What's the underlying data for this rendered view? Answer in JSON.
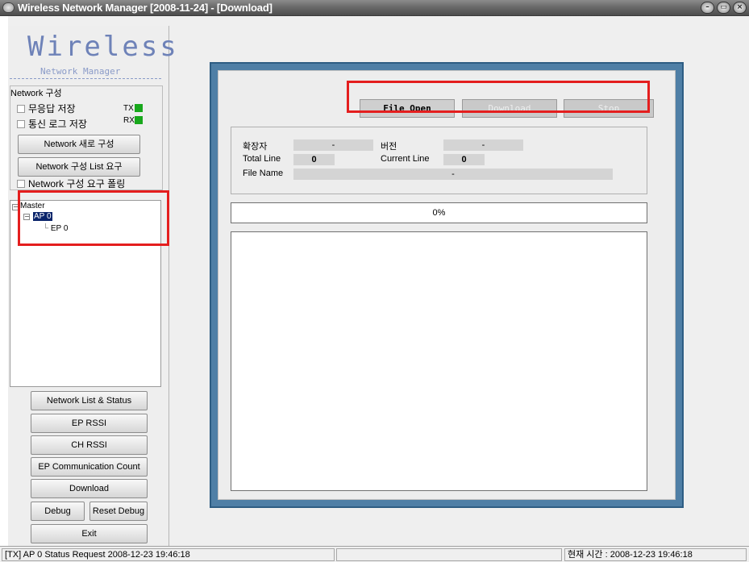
{
  "window": {
    "title": "Wireless Network Manager [2008-11-24] - [Download]"
  },
  "logo": {
    "main": "Wireless",
    "sub": "Network Manager"
  },
  "network_group": {
    "label": "Network 구성",
    "no_response_save": "무응답 저장",
    "comm_log_save": "통신 로그 저장",
    "tx_label": "TX",
    "rx_label": "RX",
    "new_config_button": "Network 새로 구성",
    "config_list_button": "Network 구성 List 요구",
    "polling_label": "Network 구성 요구 폴링"
  },
  "tree": {
    "root": "Master",
    "ap": "AP 0",
    "ep": "EP 0"
  },
  "nav_buttons": {
    "network_list_status": "Network List & Status",
    "ep_rssi": "EP RSSI",
    "ch_rssi": "CH RSSI",
    "ep_comm_count": "EP Communication Count",
    "download": "Download",
    "debug": "Debug",
    "reset_debug": "Reset Debug",
    "exit": "Exit"
  },
  "download_panel": {
    "file_open": "File Open",
    "download": "Download",
    "stop": "Stop",
    "extension_label": "확장자",
    "extension_value": "-",
    "version_label": "버전",
    "version_value": "-",
    "total_line_label": "Total Line",
    "total_line_value": "0",
    "current_line_label": "Current Line",
    "current_line_value": "0",
    "file_name_label": "File Name",
    "file_name_value": "-",
    "progress_text": "0%"
  },
  "status_bar": {
    "message": "[TX] AP 0  Status Request 2008-12-23 19:46:18",
    "middle": "",
    "clock": "현재 시간 : 2008-12-23 19:46:18"
  },
  "colors": {
    "frame_blue": "#4f7fa6",
    "highlight_red": "#e41e1e",
    "led_green": "#18a81c",
    "selection_navy": "#0a246a"
  }
}
